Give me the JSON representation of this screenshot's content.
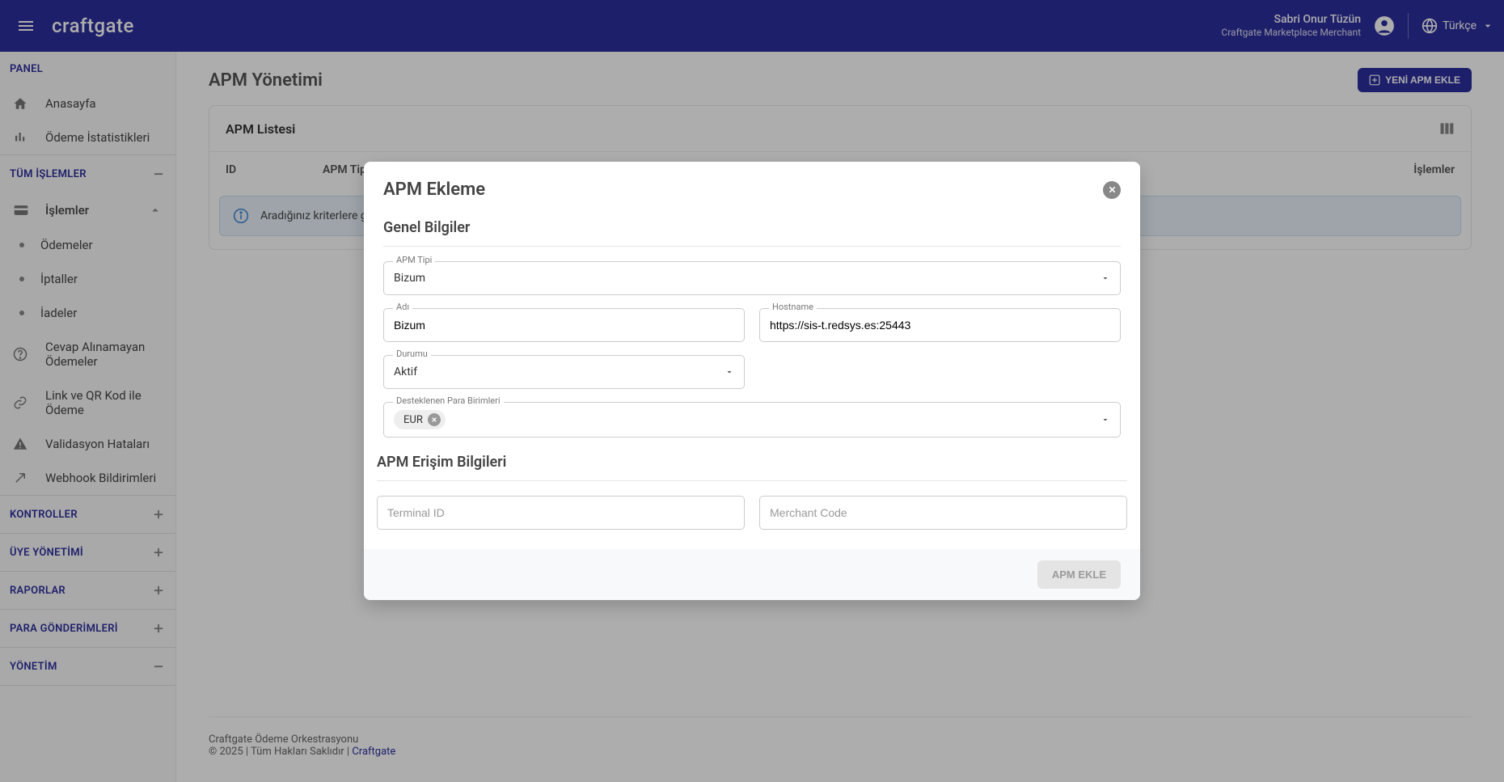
{
  "header": {
    "logo": "craftgate",
    "user_name": "Sabri Onur Tüzün",
    "user_merchant": "Craftgate Marketplace Merchant",
    "lang": "Türkçe"
  },
  "sidebar": {
    "panel_title": "PANEL",
    "panel_items": [
      {
        "label": "Anasayfa",
        "name": "sidebar-item-home"
      },
      {
        "label": "Ödeme İstatistikleri",
        "name": "sidebar-item-payment-stats"
      }
    ],
    "tx_title": "TÜM İŞLEMLER",
    "tx_parent": "İşlemler",
    "tx_subs": [
      {
        "label": "Ödemeler",
        "name": "sidebar-item-payments"
      },
      {
        "label": "İptaller",
        "name": "sidebar-item-cancellations"
      },
      {
        "label": "İadeler",
        "name": "sidebar-item-refunds"
      }
    ],
    "tx_extra": [
      {
        "label": "Cevap Alınamayan Ödemeler",
        "name": "sidebar-item-unanswered"
      },
      {
        "label": "Link ve QR Kod ile Ödeme",
        "name": "sidebar-item-link-qr"
      },
      {
        "label": "Validasyon Hataları",
        "name": "sidebar-item-validation"
      },
      {
        "label": "Webhook Bildirimleri",
        "name": "sidebar-item-webhook"
      }
    ],
    "sections": [
      {
        "label": "KONTROLLER",
        "name": "sidebar-section-controls"
      },
      {
        "label": "ÜYE YÖNETİMİ",
        "name": "sidebar-section-members"
      },
      {
        "label": "RAPORLAR",
        "name": "sidebar-section-reports"
      },
      {
        "label": "PARA GÖNDERİMLERİ",
        "name": "sidebar-section-money"
      },
      {
        "label": "YÖNETİM",
        "name": "sidebar-section-admin"
      }
    ]
  },
  "page": {
    "title": "APM Yönetimi",
    "add_btn": "YENİ APM EKLE",
    "card_title": "APM Listesi",
    "th_id": "ID",
    "th_type": "APM Tipi",
    "th_actions": "İşlemler",
    "empty_msg": "Aradığınız kriterlere g"
  },
  "footer": {
    "line1": "Craftgate Ödeme Orkestrasyonu",
    "line2_prefix": "© 2025 | Tüm Hakları Saklıdır | ",
    "link": "Craftgate"
  },
  "modal": {
    "title": "APM Ekleme",
    "section1": "Genel Bilgiler",
    "apm_type_label": "APM Tipi",
    "apm_type_value": "Bizum",
    "name_label": "Adı",
    "name_value": "Bizum",
    "hostname_label": "Hostname",
    "hostname_value": "https://sis-t.redsys.es:25443",
    "status_label": "Durumu",
    "status_value": "Aktif",
    "currencies_label": "Desteklenen Para Birimleri",
    "currency_chip": "EUR",
    "section2": "APM Erişim Bilgileri",
    "terminal_ph": "Terminal ID",
    "merchant_ph": "Merchant Code",
    "submit": "APM EKLE"
  }
}
